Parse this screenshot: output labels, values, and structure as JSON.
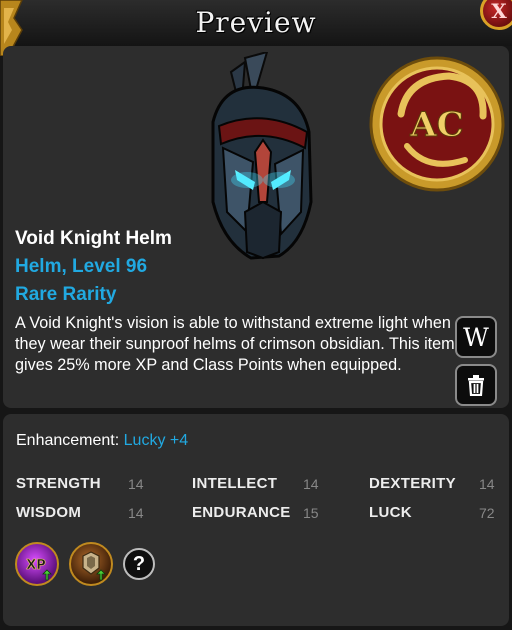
{
  "window": {
    "title": "Preview",
    "close_label": "X"
  },
  "item": {
    "name": "Void Knight Helm",
    "type_level": "Helm, Level 96",
    "rarity": "Rare Rarity",
    "description": "A Void Knight's vision is able to withstand extreme light when they wear their sunproof helms of crimson obsidian. This item gives 25% more XP and Class Points when equipped.",
    "badge_text": "AC"
  },
  "actions": {
    "wiki_label": "W",
    "trash_icon": "trash-icon"
  },
  "enhancement": {
    "label": "Enhancement:",
    "value": "Lucky +4"
  },
  "stats": [
    {
      "name": "STRENGTH",
      "value": "14"
    },
    {
      "name": "INTELLECT",
      "value": "14"
    },
    {
      "name": "DEXTERITY",
      "value": "14"
    },
    {
      "name": "WISDOM",
      "value": "14"
    },
    {
      "name": "ENDURANCE",
      "value": "15"
    },
    {
      "name": "LUCK",
      "value": "72"
    }
  ],
  "boosts": {
    "xp_label": "XP",
    "help_label": "?"
  },
  "colors": {
    "accent": "#21a9e1",
    "panel": "#2d2d2d",
    "background": "#161616",
    "gold": "#d4a52b"
  }
}
